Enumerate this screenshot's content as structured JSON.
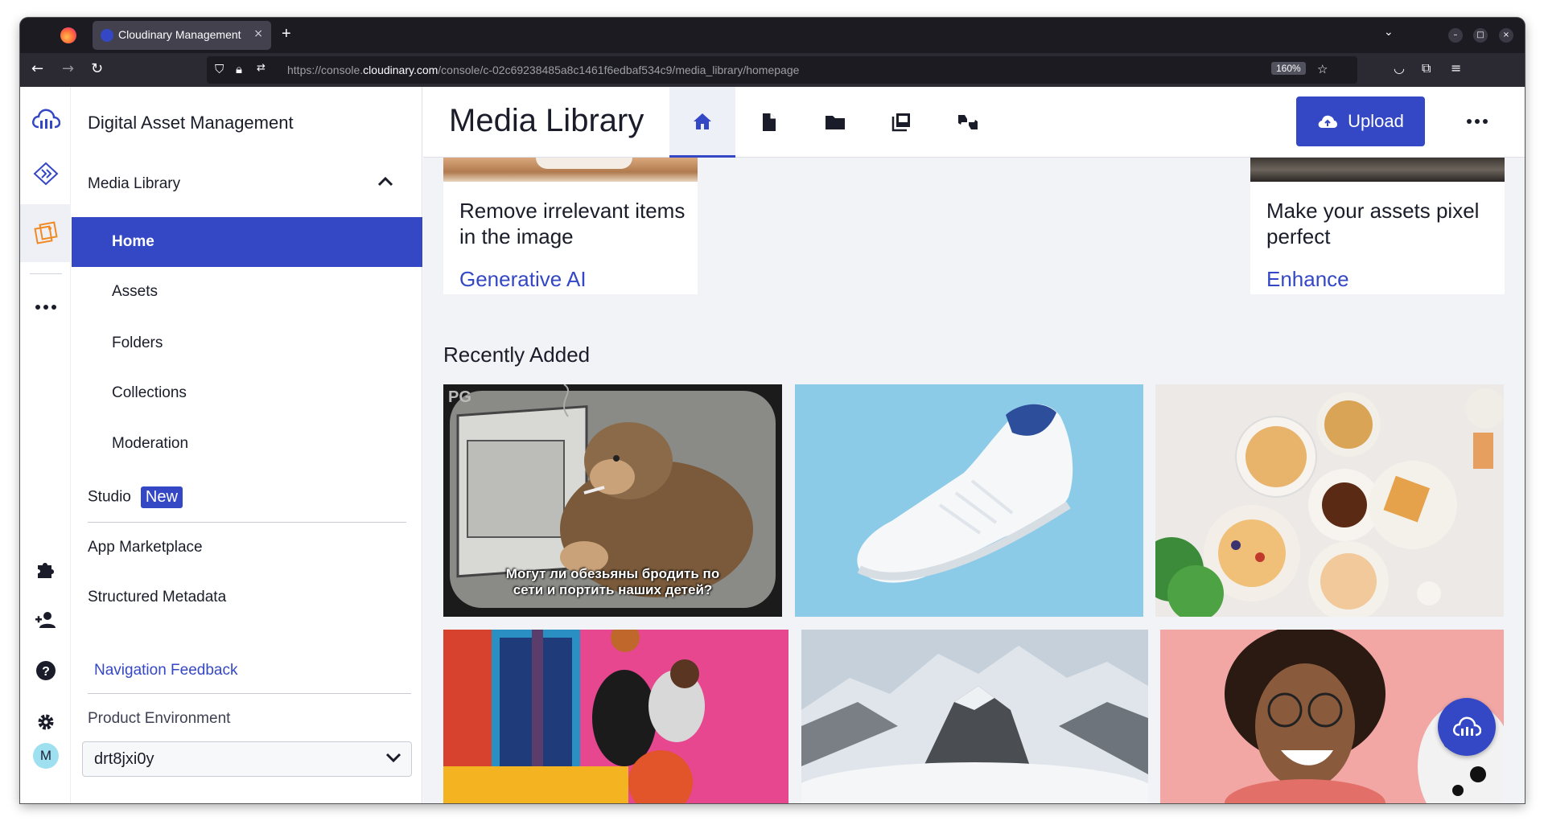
{
  "browser": {
    "tab_title": "Cloudinary Management",
    "tab_close": "×",
    "new_tab": "+",
    "url_prefix": "https://console.",
    "url_host": "cloudinary.com",
    "url_path": "/console/c-02c69238485a8c1461f6edbaf534c9/media_library/homepage",
    "zoom": "160%"
  },
  "sidebar": {
    "title": "Digital Asset Management",
    "section": "Media Library",
    "items": [
      {
        "label": "Home"
      },
      {
        "label": "Assets"
      },
      {
        "label": "Folders"
      },
      {
        "label": "Collections"
      },
      {
        "label": "Moderation"
      }
    ],
    "studio": "Studio",
    "studio_badge": "New",
    "app_marketplace": "App Marketplace",
    "structured_metadata": "Structured Metadata",
    "navigation_feedback": "Navigation Feedback",
    "env_label": "Product Environment",
    "env_value": "drt8jxi0y"
  },
  "rail": {
    "avatar_initial": "M"
  },
  "header": {
    "title": "Media Library",
    "upload_label": "Upload"
  },
  "cards": [
    {
      "text": "Remove irrelevant items in the image",
      "link": "Generative AI"
    },
    {
      "text": "Make your assets pixel perfect",
      "link": "Enhance"
    }
  ],
  "recent": {
    "heading": "Recently Added",
    "thumb1_caption_line1": "Могут ли обезьяны бродить по",
    "thumb1_caption_line2": "сети и портить наших детей?",
    "thumb1_corner": "PG"
  },
  "colors": {
    "accent": "#3448c5",
    "rail_active": "#f08a24"
  }
}
